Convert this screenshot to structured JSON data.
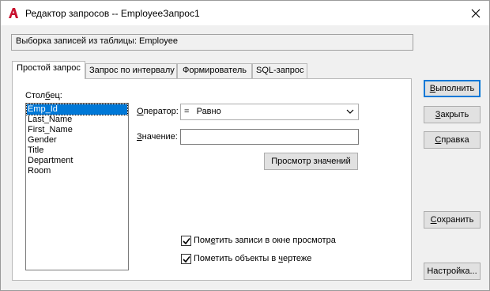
{
  "window": {
    "title": "Редактор запросов -- EmployeeЗапрос1",
    "close_glyph": "✕"
  },
  "info": {
    "text": "Выборка записей из таблицы:  Employee"
  },
  "tabs": [
    {
      "label": "Простой запрос",
      "active": true
    },
    {
      "label": "Запрос по интервалу",
      "active": false
    },
    {
      "label": "Формирователь",
      "active": false
    },
    {
      "label": "SQL-запрос",
      "active": false
    }
  ],
  "column": {
    "label_pre": "Стол",
    "label_u": "б",
    "label_post": "ец:",
    "items": [
      "Emp_Id",
      "Last_Name",
      "First_Name",
      "Gender",
      "Title",
      "Department",
      "Room"
    ],
    "selected_index": 0
  },
  "operator": {
    "label_u": "О",
    "label_rest": "ператор:",
    "value": "=   Равно"
  },
  "value_field": {
    "label_u": "З",
    "label_rest": "начение:",
    "value": ""
  },
  "buttons": {
    "browse_values": "Просмотр значений",
    "execute_u": "В",
    "execute_rest": "ыполнить",
    "close_u": "З",
    "close_rest": "акрыть",
    "help_u": "С",
    "help_rest": "правка",
    "save_u": "С",
    "save_rest": "охранить",
    "settings": "Настройка..."
  },
  "checkboxes": {
    "highlight_pre": "Пом",
    "highlight_u": "е",
    "highlight_post": "тить записи в окне просмотра",
    "highlight_checked": true,
    "mark_pre": "Пометить объекты в ",
    "mark_u": "ч",
    "mark_post": "ертеже",
    "mark_checked": true
  },
  "colors": {
    "selection": "#0078d7",
    "app_icon": "#c8102e"
  }
}
